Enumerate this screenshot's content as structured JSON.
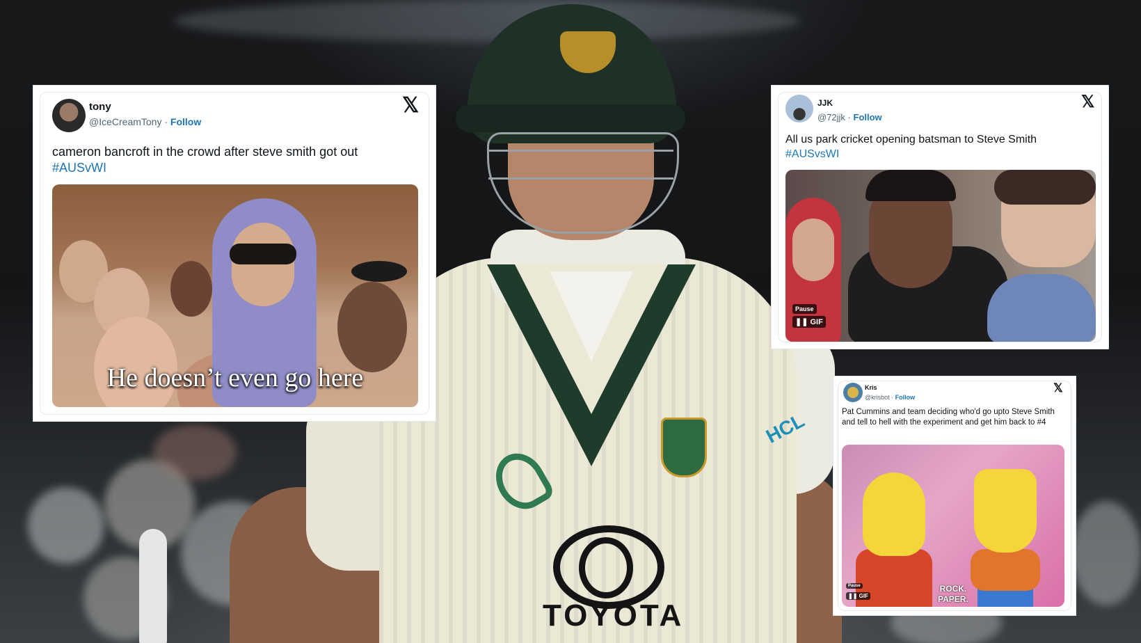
{
  "tweets": [
    {
      "name": "tony",
      "handle": "@IceCreamTony",
      "separator": " · ",
      "follow": "Follow",
      "text": "cameron bancroft in the crowd after steve smith got out",
      "hashtag": "#AUSvWI",
      "media_caption": "He doesn’t even go here",
      "platform_icon": "x-logo-icon"
    },
    {
      "name": "JJK",
      "handle": "@72jjk",
      "separator": " · ",
      "follow": "Follow",
      "text": "All us park cricket opening batsman to Steve Smith",
      "hashtag": "#AUSvsWI",
      "media_badge_pause": "Pause",
      "media_badge_gif": "GIF",
      "platform_icon": "x-logo-icon"
    },
    {
      "name": "Kris",
      "handle": "@krisbot",
      "separator": " · ",
      "follow": "Follow",
      "text": "Pat Cummins and team deciding who'd go upto Steve Smith and tell to hell with the experiment and get him back to #4",
      "media_badge_pause": "Pause",
      "media_badge_gif": "GIF",
      "media_caption_line1": "ROCK.",
      "media_caption_line2": "PAPER.",
      "platform_icon": "x-logo-icon"
    }
  ],
  "background_text": {
    "sponsor": "TOYOTA",
    "sleeve_sponsor": "HCL"
  },
  "colors": {
    "link": "#1d74b8",
    "text": "#0f1419",
    "muted": "#536471",
    "jersey": "#ece8d6",
    "jersey_trim": "#1f3b2c"
  }
}
